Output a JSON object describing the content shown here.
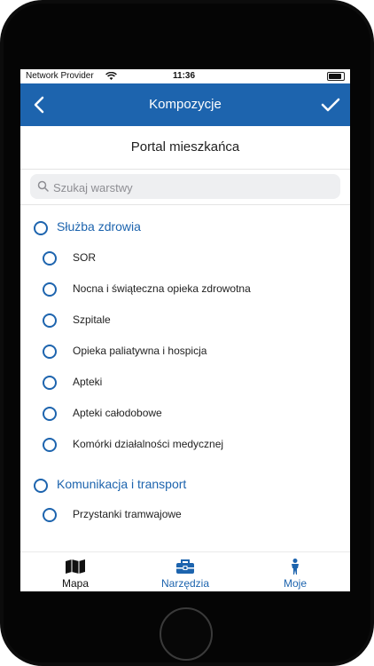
{
  "status": {
    "provider": "Network Provider",
    "time": "11:36"
  },
  "nav": {
    "title": "Kompozycje",
    "back_icon": "chevron-left-icon",
    "confirm_icon": "checkmark-icon"
  },
  "portal_title": "Portal mieszkańca",
  "search": {
    "placeholder": "Szukaj warstwy",
    "value": ""
  },
  "groups": [
    {
      "label": "Służba zdrowia",
      "items": [
        "SOR",
        "Nocna i świąteczna opieka zdrowotna",
        "Szpitale",
        "Opieka paliatywna i hospicja",
        "Apteki",
        "Apteki całodobowe",
        "Komórki działalności medycznej"
      ]
    },
    {
      "label": "Komunikacja i transport",
      "items": [
        "Przystanki tramwajowe"
      ]
    }
  ],
  "tabbar": {
    "tabs": [
      {
        "label": "Mapa",
        "icon": "map-icon",
        "color": "#111111"
      },
      {
        "label": "Narzędzia",
        "icon": "toolbox-icon",
        "color": "#1d64ae"
      },
      {
        "label": "Moje",
        "icon": "person-icon",
        "color": "#1d64ae"
      }
    ]
  },
  "colors": {
    "accent": "#1d64ae",
    "nav_bg": "#1d64ae"
  }
}
